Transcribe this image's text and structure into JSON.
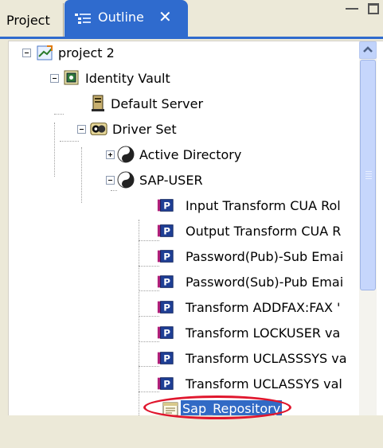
{
  "tabs": {
    "project_label": "Project",
    "outline_label": "Outline",
    "close_glyph": "✕"
  },
  "toolbar": {
    "buttons": [
      "hierarchy-view-icon",
      "properties-view-icon",
      "filter-icon",
      "expand-all-icon",
      "collapse-all-icon",
      "link-with-editor-icon"
    ]
  },
  "tree": {
    "project": "project 2",
    "identity_vault": "Identity Vault",
    "default_server": "Default Server",
    "driver_set": "Driver Set",
    "active_directory": "Active Directory",
    "sap_user": "SAP-USER",
    "policies": [
      "Input Transform CUA Rol",
      "Output Transform CUA R",
      "Password(Pub)-Sub Emai",
      "Password(Sub)-Pub Emai",
      "Transform ADDFAX:FAX '",
      "Transform LOCKUSER va",
      "Transform UCLASSSYS va",
      "Transform UCLASSYS val"
    ],
    "sap_repository": "Sap_Repository"
  },
  "colors": {
    "tab_active": "#2f6bce",
    "selection": "#316ac5",
    "highlight_oval": "#e0162d",
    "policy_icon_blue": "#1f3f95",
    "policy_icon_accent": "#b0207a"
  }
}
